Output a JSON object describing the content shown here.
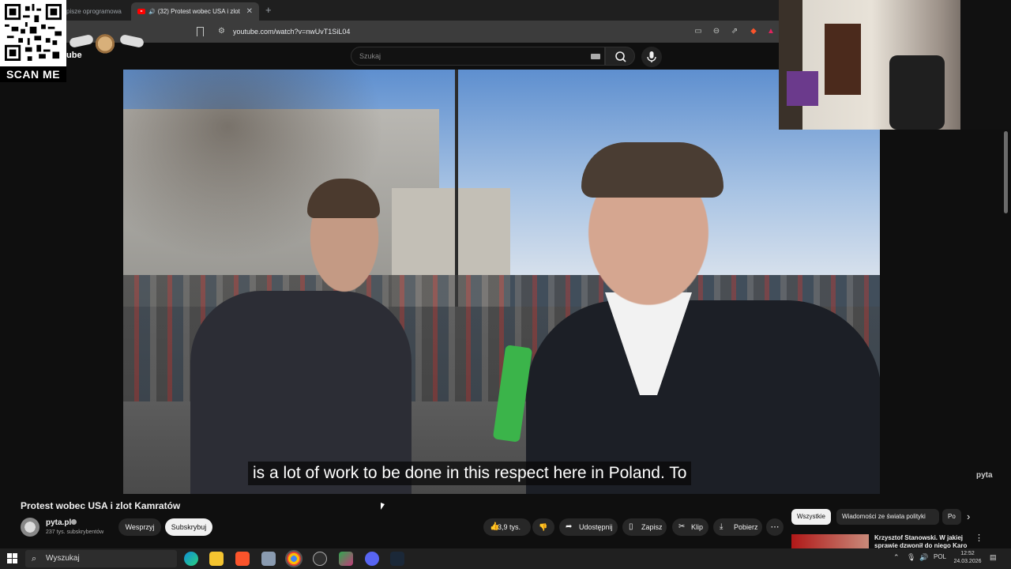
{
  "browser": {
    "tabs": [
      {
        "label": "pisze oprogramowa",
        "active": false
      },
      {
        "label": "(32) Protest wobec USA i zlot",
        "active": true
      }
    ],
    "url": "youtube.com/watch?v=nwUvT1SiL04"
  },
  "overlay": {
    "scan_me": "SCAN ME",
    "logo_fragment": "ube",
    "watermark": "pyta"
  },
  "youtube": {
    "search_placeholder": "Szukaj",
    "caption": "is a lot of work to be done in this respect here in Poland.  To",
    "video_title": "Protest wobec USA i zlot Kamratów",
    "channel": {
      "name": "pyta.pl",
      "subscribers": "237 tys. subskrybentów"
    },
    "buttons": {
      "support": "Wesprzyj",
      "subscribe": "Subskrybuj",
      "likes": "3,9 tys.",
      "share": "Udostępnij",
      "save": "Zapisz",
      "clip": "Klip",
      "download": "Pobierz"
    },
    "chips": [
      "Wszystkie",
      "Wiadomości ze świata polityki",
      "Po"
    ],
    "recommendation": {
      "title": "Krzysztof Stanowski. W jakiej sprawie dzwonił do niego Karo"
    }
  },
  "taskbar": {
    "search_placeholder": "Wyszukaj",
    "lang": "POL",
    "time": "12:52",
    "date": "24.03.2026"
  },
  "colors": {
    "youtube_red": "#ff0000",
    "background": "#0f0f0f",
    "pill": "#272727",
    "caption_bg": "#080808"
  }
}
